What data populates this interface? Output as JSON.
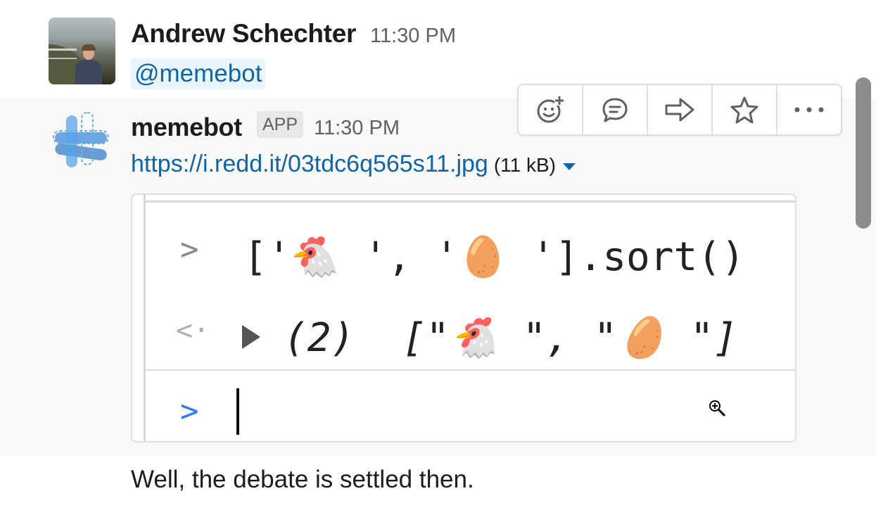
{
  "message1": {
    "author": "Andrew Schechter",
    "time": "11:30 PM",
    "mention": "@memebot"
  },
  "message2": {
    "author": "memebot",
    "badge": "APP",
    "time": "11:30 PM",
    "link": "https://i.redd.it/03tdc6q565s11.jpg",
    "file_size": "(11 kB)",
    "preview": {
      "input_line": "['🐔 ', '🥚 '].sort()",
      "count": "(2)",
      "output_line": "[\"🐔 \", \"🥚 \"]"
    }
  },
  "message3": {
    "text": "Well, the debate is settled then."
  },
  "toolbar": {
    "icons": [
      "add-reaction-icon",
      "reply-thread-icon",
      "share-message-icon",
      "star-icon",
      "more-actions-icon"
    ]
  },
  "colors": {
    "link": "#1264a3",
    "mention_bg": "#e8f5fa",
    "hover_bg": "#f8f8f8"
  }
}
